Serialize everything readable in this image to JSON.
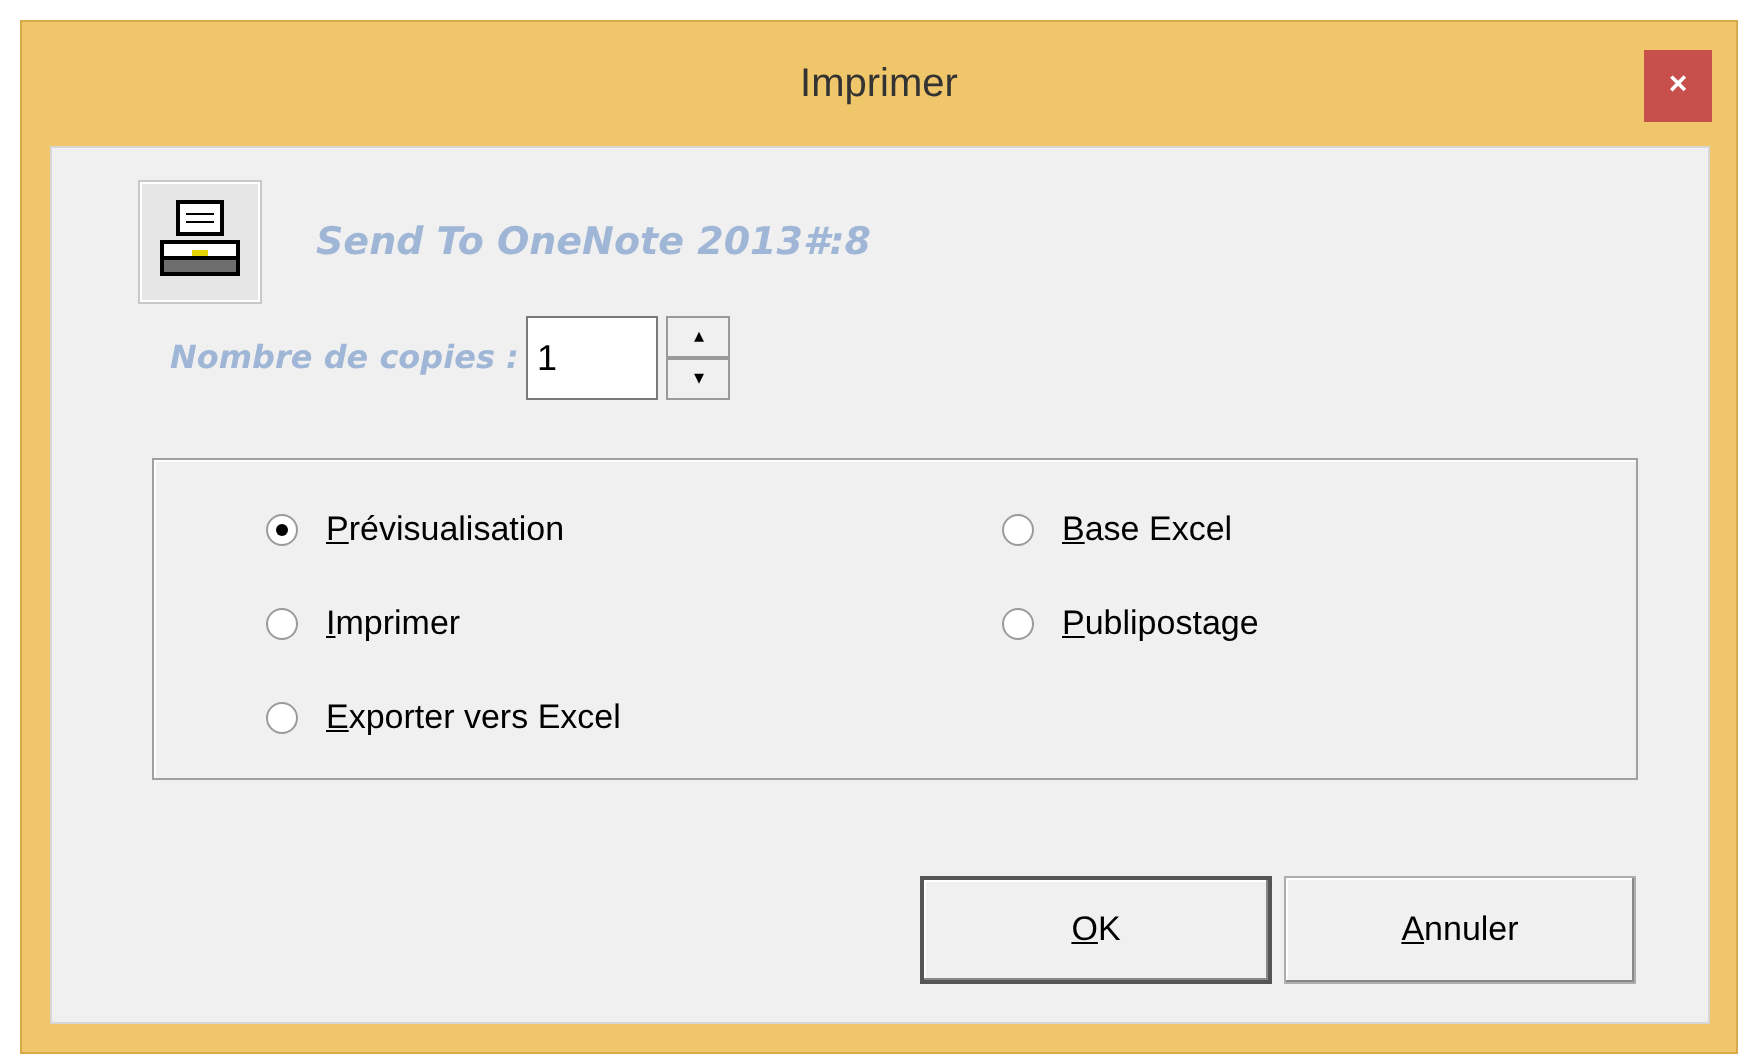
{
  "window": {
    "title": "Imprimer",
    "close": "×"
  },
  "printer": {
    "name": "Send To OneNote 2013#:8"
  },
  "copies": {
    "label": "Nombre de copies :",
    "value": "1",
    "up": "▴",
    "down": "▾"
  },
  "options": [
    {
      "label": "Prévisualisation",
      "selected": true
    },
    {
      "label": "Imprimer",
      "selected": false
    },
    {
      "label": "Exporter vers Excel",
      "selected": false
    },
    {
      "label": "Base Excel",
      "selected": false
    },
    {
      "label": "Publipostage",
      "selected": false
    }
  ],
  "buttons": [
    {
      "label": "OK",
      "default": true
    },
    {
      "label": "Annuler",
      "default": false
    }
  ]
}
